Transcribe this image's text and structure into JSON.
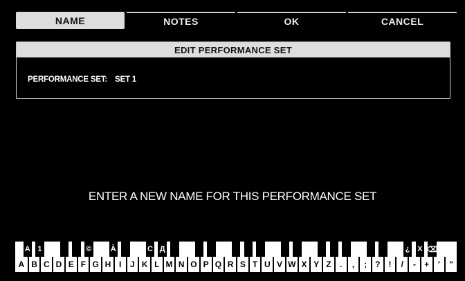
{
  "tabs": [
    {
      "label": "NAME",
      "active": true
    },
    {
      "label": "NOTES",
      "active": false
    },
    {
      "label": "OK",
      "active": false
    },
    {
      "label": "CANCEL",
      "active": false
    }
  ],
  "panel": {
    "title": "EDIT PERFORMANCE SET",
    "field_label": "PERFORMANCE SET:",
    "field_value": "SET 1"
  },
  "prompt": "ENTER A NEW NAME FOR THIS PERFORMANCE SET",
  "keyboard": {
    "white_keys": [
      "A",
      "B",
      "C",
      "D",
      "E",
      "F",
      "G",
      "H",
      "I",
      "J",
      "K",
      "L",
      "M",
      "N",
      "O",
      "P",
      "Q",
      "R",
      "S",
      "T",
      "U",
      "V",
      "W",
      "X",
      "Y",
      "Z",
      ".",
      ",",
      ";",
      "?",
      "!",
      "/",
      "-",
      "+",
      "'",
      "\""
    ],
    "black_keys": [
      "A",
      "1",
      "",
      "",
      "©",
      "À",
      "",
      "C",
      "Д",
      "",
      "",
      "",
      "",
      "",
      "",
      "",
      "",
      "",
      "",
      "",
      "",
      "",
      "¿",
      "X",
      "⌫",
      "«",
      "»",
      "◀",
      "▶",
      "␣"
    ]
  },
  "colors": {
    "background": "#000000",
    "accent": "#dddddd"
  }
}
